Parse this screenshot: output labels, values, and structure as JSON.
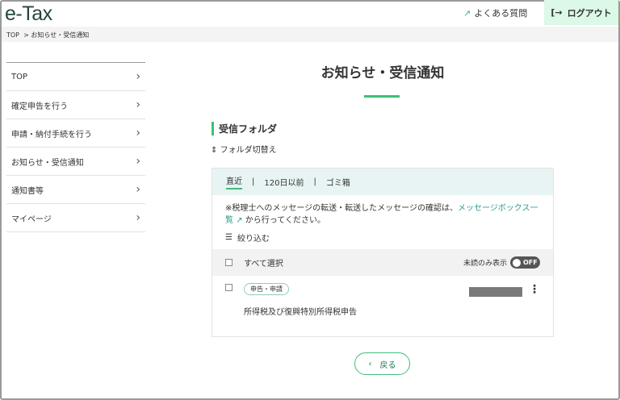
{
  "header": {
    "logo": "e-Tax",
    "faq": "よくある質問",
    "logout": "ログアウト"
  },
  "breadcrumb": {
    "top": "TOP",
    "sep": ">",
    "current": "お知らせ・受信通知"
  },
  "sidebar": {
    "items": [
      {
        "label": "TOP"
      },
      {
        "label": "確定申告を行う"
      },
      {
        "label": "申請・納付手続を行う"
      },
      {
        "label": "お知らせ・受信通知"
      },
      {
        "label": "通知書等"
      },
      {
        "label": "マイページ"
      }
    ]
  },
  "main": {
    "title": "お知らせ・受信通知",
    "folder": "受信フォルダ",
    "switch": "フォルダ切替え",
    "tabs": [
      {
        "label": "直近"
      },
      {
        "label": "120日以前"
      },
      {
        "label": "ゴミ箱"
      }
    ],
    "note_prefix": "※税理士へのメッセージの転送・転送したメッセージの確認は、",
    "note_link": "メッセージボックス一覧",
    "note_suffix": "から行ってください。",
    "filter": "絞り込む",
    "select_all": "すべて選択",
    "unread_only": "未読のみ表示",
    "toggle": "OFF",
    "message": {
      "badge": "申告・申請",
      "subject": "所得税及び復興特別所得税申告"
    },
    "back": "戻る"
  }
}
